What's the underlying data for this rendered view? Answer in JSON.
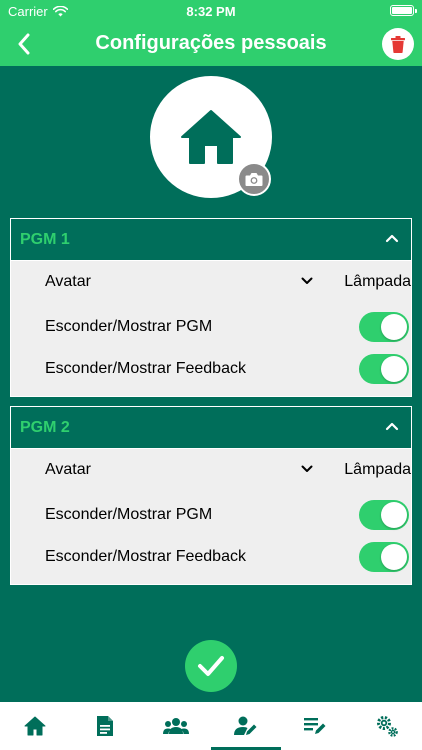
{
  "status_bar": {
    "carrier": "Carrier",
    "time": "8:32 PM"
  },
  "nav": {
    "title": "Configurações pessoais",
    "back_icon": "chevron-left-icon",
    "delete_icon": "trash-icon"
  },
  "avatar": {
    "icon": "home-icon",
    "camera_icon": "camera-icon"
  },
  "pgms": [
    {
      "name": "PGM 1",
      "expanded": true,
      "avatar_label": "Avatar",
      "avatar_value": "Lâmpada",
      "toggles": [
        {
          "label": "Esconder/Mostrar PGM",
          "on": true
        },
        {
          "label": "Esconder/Mostrar Feedback",
          "on": true
        }
      ]
    },
    {
      "name": "PGM 2",
      "expanded": true,
      "avatar_label": "Avatar",
      "avatar_value": "Lâmpada",
      "toggles": [
        {
          "label": "Esconder/Mostrar PGM",
          "on": true
        },
        {
          "label": "Esconder/Mostrar Feedback",
          "on": true
        }
      ]
    }
  ],
  "confirm_icon": "checkmark-icon",
  "tabs": [
    {
      "icon": "home-icon",
      "active": false
    },
    {
      "icon": "document-icon",
      "active": false
    },
    {
      "icon": "users-icon",
      "active": false
    },
    {
      "icon": "user-edit-icon",
      "active": true
    },
    {
      "icon": "list-edit-icon",
      "active": false
    },
    {
      "icon": "gears-icon",
      "active": false
    }
  ],
  "colors": {
    "primary": "#006e5a",
    "accent": "#2fcf6e",
    "danger": "#e53935",
    "card_bg": "#efefef"
  }
}
